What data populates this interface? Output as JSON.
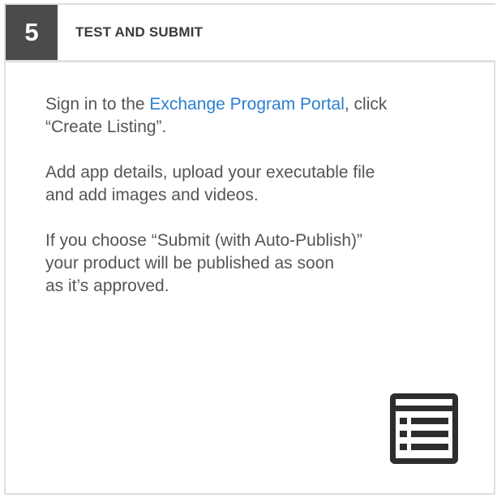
{
  "step": {
    "number": "5",
    "title": "TEST AND SUBMIT"
  },
  "content": {
    "para1": {
      "before": "Sign in to the ",
      "link": "Exchange Program Portal",
      "after": ", click",
      "line2": "“Create Listing”."
    },
    "para2": {
      "line1": "Add app details, upload your executable file",
      "line2": "and add images and videos."
    },
    "para3": {
      "line1": "If you choose “Submit (with Auto-Publish)”",
      "line2": "your product will be published as soon",
      "line3": "as it’s approved."
    }
  },
  "icons": {
    "list": "list-icon"
  },
  "colors": {
    "step_badge": "#4b4b4b",
    "link": "#2a7fd0",
    "text": "#555555",
    "border": "#dedede"
  }
}
